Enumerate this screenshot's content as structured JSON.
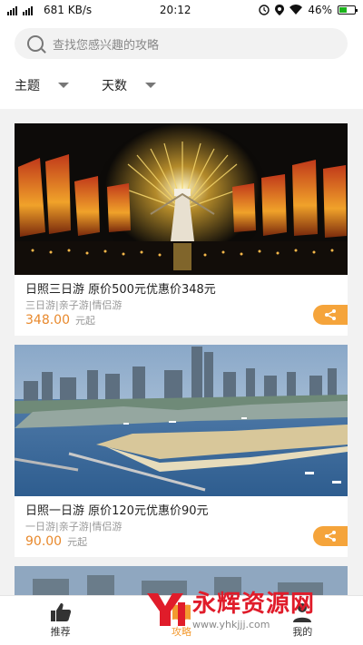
{
  "status": {
    "left_text": "681 KB/s",
    "time": "20:12",
    "battery": "46%"
  },
  "search": {
    "placeholder": "查找您感兴趣的攻略"
  },
  "filters": [
    {
      "label": "主题"
    },
    {
      "label": "天数"
    }
  ],
  "cards": [
    {
      "title": "日照三日游 原价500元优惠价348元",
      "tags": "三日游|亲子游|情侣游",
      "price": "348.00",
      "unit": "元起"
    },
    {
      "title": "日照一日游 原价120元优惠价90元",
      "tags": "一日游|亲子游|情侣游",
      "price": "90.00",
      "unit": "元起"
    }
  ],
  "tabbar": [
    {
      "label": "推荐"
    },
    {
      "label": "攻略"
    },
    {
      "label": "我的"
    }
  ],
  "watermark": {
    "title": "永辉资源网",
    "url": "www.yhkjjj.com"
  },
  "colors": {
    "accent": "#f39a30",
    "price": "#e8892d"
  }
}
